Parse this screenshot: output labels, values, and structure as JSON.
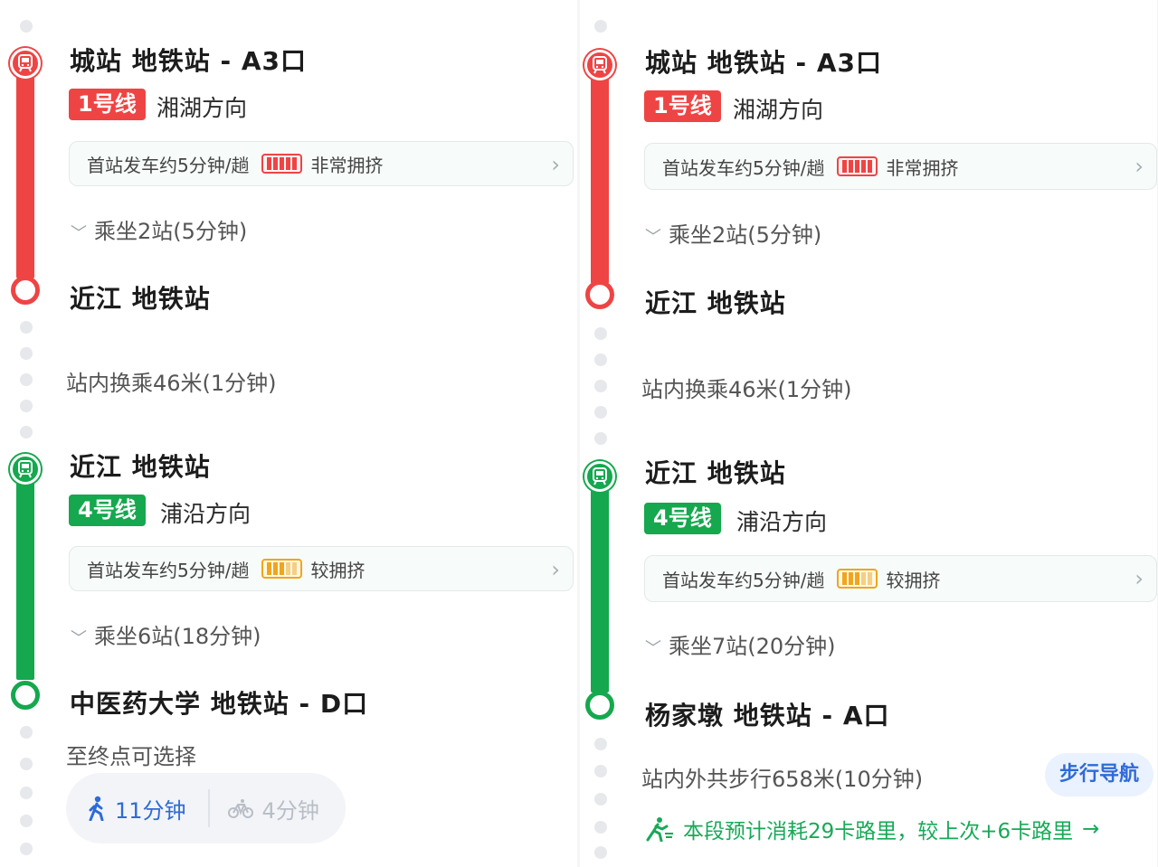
{
  "left": {
    "segment1": {
      "station": "城站 地铁站 - A3口",
      "line_label": "1号线",
      "direction": "湘湖方向",
      "info_text": "首站发车约5分钟/趟",
      "crowd_status": "非常拥挤",
      "ride": "乘坐2站(5分钟)",
      "end_station": "近江 地铁站"
    },
    "transfer": "站内换乘46米(1分钟)",
    "segment2": {
      "station": "近江 地铁站",
      "line_label": "4号线",
      "direction": "浦沿方向",
      "info_text": "首站发车约5分钟/趟",
      "crowd_status": "较拥挤",
      "ride": "乘坐6站(18分钟)",
      "end_station": "中医药大学 地铁站 - D口"
    },
    "destination_note": "至终点可选择",
    "walk_option": "11分钟",
    "bike_option": "4分钟"
  },
  "right": {
    "segment1": {
      "station": "城站 地铁站 - A3口",
      "line_label": "1号线",
      "direction": "湘湖方向",
      "info_text": "首站发车约5分钟/趟",
      "crowd_status": "非常拥挤",
      "ride": "乘坐2站(5分钟)",
      "end_station": "近江 地铁站"
    },
    "transfer": "站内换乘46米(1分钟)",
    "segment2": {
      "station": "近江 地铁站",
      "line_label": "4号线",
      "direction": "浦沿方向",
      "info_text": "首站发车约5分钟/趟",
      "crowd_status": "较拥挤",
      "ride": "乘坐7站(20分钟)",
      "end_station": "杨家墩 地铁站 - A口"
    },
    "walk_text": "站内外共步行658米(10分钟)",
    "walk_nav_button": "步行导航",
    "calorie_note": "本段预计消耗29卡路里，较上次+6卡路里",
    "calorie_arrow": "→"
  },
  "colors": {
    "line1": "#ef4444",
    "line4": "#15a84e",
    "link_blue": "#2e6bd6",
    "calorie_green": "#18a957"
  },
  "icons": [
    "metro-icon",
    "walk-icon",
    "bike-icon",
    "crowd-icon",
    "chevron-right-icon",
    "chevron-down-icon",
    "running-icon"
  ]
}
